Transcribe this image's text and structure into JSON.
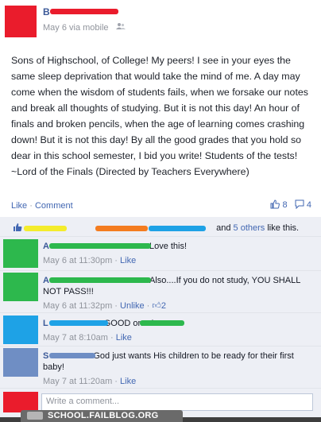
{
  "post": {
    "author_initial": "B",
    "meta": "May 6 via mobile",
    "text": "Sons of Highschool, of College! My peers! I see in your eyes the same sleep deprivation that would take the mind of me. A day may come when the wisdom of students fails, when we forsake our notes and break all thoughts of studying. But it is not this day! An hour of finals and broken pencils, when the age of learning comes crashing down! But it is not this day! By all the good grades that you hold so dear in this school semester, I bid you write! Students of the tests! ~Lord of the Finals (Directed by Teachers Everywhere)",
    "like_label": "Like",
    "comment_label": "Comment",
    "separator": "·",
    "likes_count": "8",
    "comments_count": "4"
  },
  "likes_bar": {
    "prefix": "and",
    "others": "5 others",
    "suffix": "like this."
  },
  "comments": [
    {
      "initial": "A",
      "text": "Love this!",
      "time": "May 6 at 11:30pm",
      "like_label": "Like",
      "avatar_color": "#2db84d"
    },
    {
      "initial": "A",
      "text": "Also....If you do not study, YOU SHALL NOT PASS!!!",
      "time": "May 6 at 11:32pm",
      "like_label": "Unlike",
      "like_count": "2",
      "avatar_color": "#2db84d"
    },
    {
      "initial": "L",
      "text": "GOOD one A",
      "time": "May 7 at 8:10am",
      "like_label": "Like",
      "avatar_color": "#1ea2e6"
    },
    {
      "initial": "S",
      "text": "God just wants His children to be ready for their first baby!",
      "time": "May 7 at 11:20am",
      "like_label": "Like",
      "avatar_color": "#6f8ec4"
    }
  ],
  "write_comment": {
    "placeholder": "Write a comment..."
  },
  "watermark": {
    "text": "SCHOOL.FAILBLOG.ORG"
  },
  "colors": {
    "accent": "#4267b2",
    "redaction_red": "#ea1c2c",
    "redaction_green": "#2db84d",
    "redaction_blue": "#1ea2e6",
    "redaction_orange": "#f47c20",
    "redaction_yellow": "#f4ec2c"
  }
}
